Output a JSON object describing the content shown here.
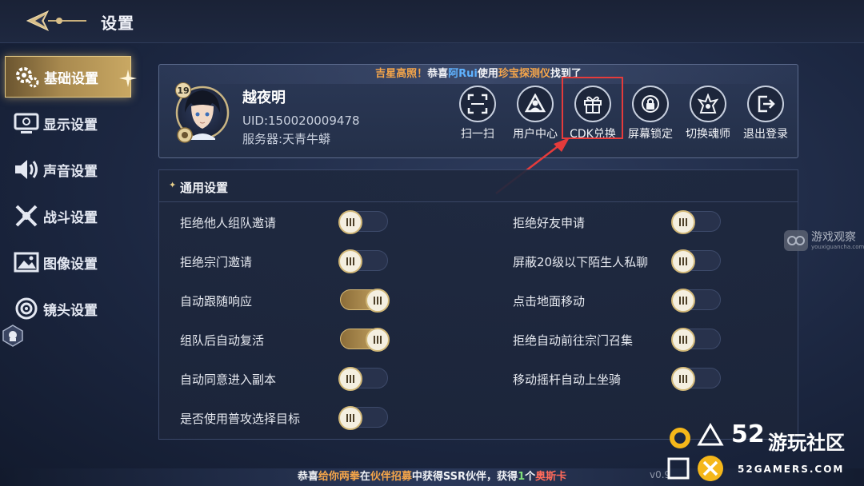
{
  "header": {
    "title": "设置"
  },
  "sidebar": {
    "items": [
      {
        "label": "基础设置",
        "icon": "gear-icon",
        "active": true
      },
      {
        "label": "显示设置",
        "icon": "monitor-icon",
        "active": false
      },
      {
        "label": "声音设置",
        "icon": "speaker-icon",
        "active": false
      },
      {
        "label": "战斗设置",
        "icon": "crossed-swords-icon",
        "active": false
      },
      {
        "label": "图像设置",
        "icon": "image-icon",
        "active": false
      },
      {
        "label": "镜头设置",
        "icon": "camera-lens-icon",
        "active": false
      }
    ]
  },
  "profile": {
    "announcement": {
      "part1": "吉星高照！",
      "part2": "恭喜",
      "part3": "阿Rui",
      "part4": "使用",
      "part5": "珍宝探测仪",
      "part6": "找到了"
    },
    "level": "19",
    "name": "越夜明",
    "uid": "UID:150020009478",
    "server": "服务器:天青牛蟒",
    "actions": [
      {
        "label": "扫一扫",
        "icon": "scan-icon"
      },
      {
        "label": "用户中心",
        "icon": "user-center-icon"
      },
      {
        "label": "CDK兑换",
        "icon": "gift-icon"
      },
      {
        "label": "屏幕锁定",
        "icon": "lock-icon"
      },
      {
        "label": "切换魂师",
        "icon": "switch-character-icon"
      },
      {
        "label": "退出登录",
        "icon": "logout-icon"
      }
    ]
  },
  "general_settings": {
    "title": "通用设置",
    "left": [
      {
        "label": "拒绝他人组队邀请",
        "on": false
      },
      {
        "label": "拒绝宗门邀请",
        "on": false
      },
      {
        "label": "自动跟随响应",
        "on": true
      },
      {
        "label": "组队后自动复活",
        "on": true
      },
      {
        "label": "自动同意进入副本",
        "on": false
      },
      {
        "label": "是否使用普攻选择目标",
        "on": false
      }
    ],
    "right": [
      {
        "label": "拒绝好友申请",
        "on": false
      },
      {
        "label": "屏蔽20级以下陌生人私聊",
        "on": false
      },
      {
        "label": "点击地面移动",
        "on": false
      },
      {
        "label": "拒绝自动前往宗门召集",
        "on": false
      },
      {
        "label": "移动摇杆自动上坐骑",
        "on": false
      }
    ]
  },
  "ticker": {
    "p1": "恭喜",
    "p2": "给你两拳",
    "p3": "在",
    "p4": "伙伴招募",
    "p5": "中获得SSR伙伴，获得",
    "p6": "1",
    "p7": "个",
    "p8": "奥斯卡"
  },
  "version": "v0.9",
  "watermarks": {
    "youxi_title": "游戏观察",
    "youxi_url": "youxiguancha.com",
    "logo_num": "52",
    "logo_zh": "游玩社区",
    "logo_en": "52GAMERS.COM"
  },
  "colors": {
    "accent_gold": "#c9a865",
    "highlight_red": "#e53b3b",
    "link_blue": "#5fb2ff",
    "orange": "#f6a64a"
  }
}
